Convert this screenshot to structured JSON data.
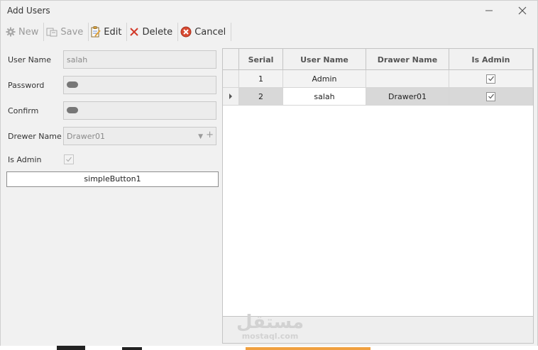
{
  "window": {
    "title": "Add Users"
  },
  "toolbar": {
    "new_label": "New",
    "save_label": "Save",
    "edit_label": "Edit",
    "delete_label": "Delete",
    "cancel_label": "Cancel"
  },
  "form": {
    "username_label": "User Name",
    "username_value": "salah",
    "password_label": "Password",
    "confirm_label": "Confirm",
    "drawer_label": "Drewer Name",
    "drawer_value": "Drawer01",
    "is_admin_label": "Is Admin",
    "is_admin_checked": true,
    "simple_button_label": "simpleButton1"
  },
  "grid": {
    "columns": [
      "Serial",
      "User Name",
      "Drawer Name",
      "Is Admin"
    ],
    "rows": [
      {
        "serial": "1",
        "user_name": "Admin",
        "drawer_name": "",
        "is_admin": true
      },
      {
        "serial": "2",
        "user_name": "salah",
        "drawer_name": "Drawer01",
        "is_admin": true
      }
    ]
  },
  "watermark": {
    "arabic": "مستقل",
    "latin": "mostaql.com"
  },
  "colors": {
    "delete_icon": "#d23a2a",
    "cancel_icon": "#d84a32",
    "edit_icon": "#e0a23a"
  }
}
